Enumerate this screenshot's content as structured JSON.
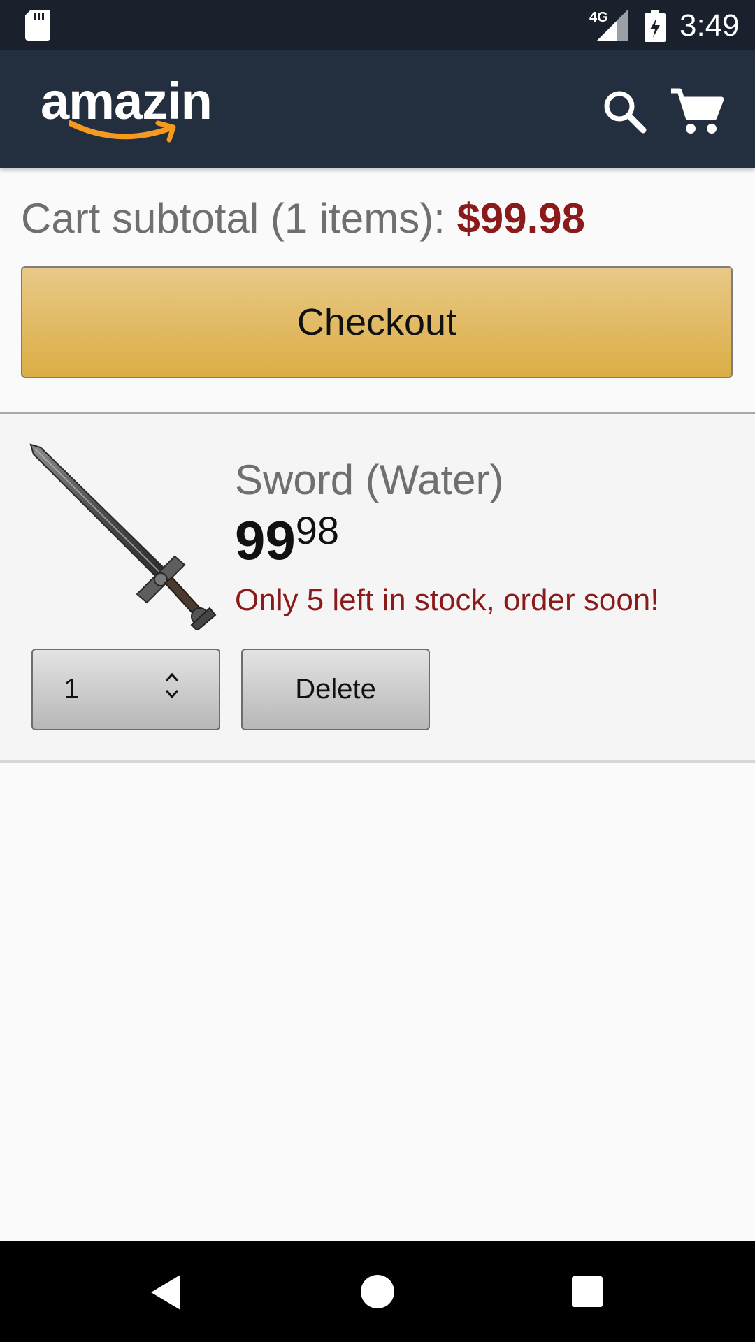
{
  "status_bar": {
    "time": "3:49",
    "network_label": "4G",
    "icons": [
      "sd-card-icon",
      "signal-icon",
      "battery-charging-icon"
    ]
  },
  "app_bar": {
    "logo_text": "amazin",
    "logo_accent_color": "#f59a1e",
    "background_color": "#232f3e",
    "icons": [
      "search-icon",
      "cart-icon"
    ]
  },
  "cart": {
    "subtotal_label": "Cart subtotal (1 items):",
    "subtotal_amount": "$99.98",
    "subtotal_amount_color": "#8b1a1a",
    "checkout_label": "Checkout",
    "items": [
      {
        "title": "Sword (Water)",
        "image_icon": "sword-image",
        "price_whole": "99",
        "price_fraction": "98",
        "stock_message": "Only 5 left in stock, order soon!",
        "quantity": "1",
        "delete_label": "Delete"
      }
    ]
  },
  "nav_bar": {
    "icons": [
      "back-icon",
      "home-icon",
      "recents-icon"
    ]
  }
}
